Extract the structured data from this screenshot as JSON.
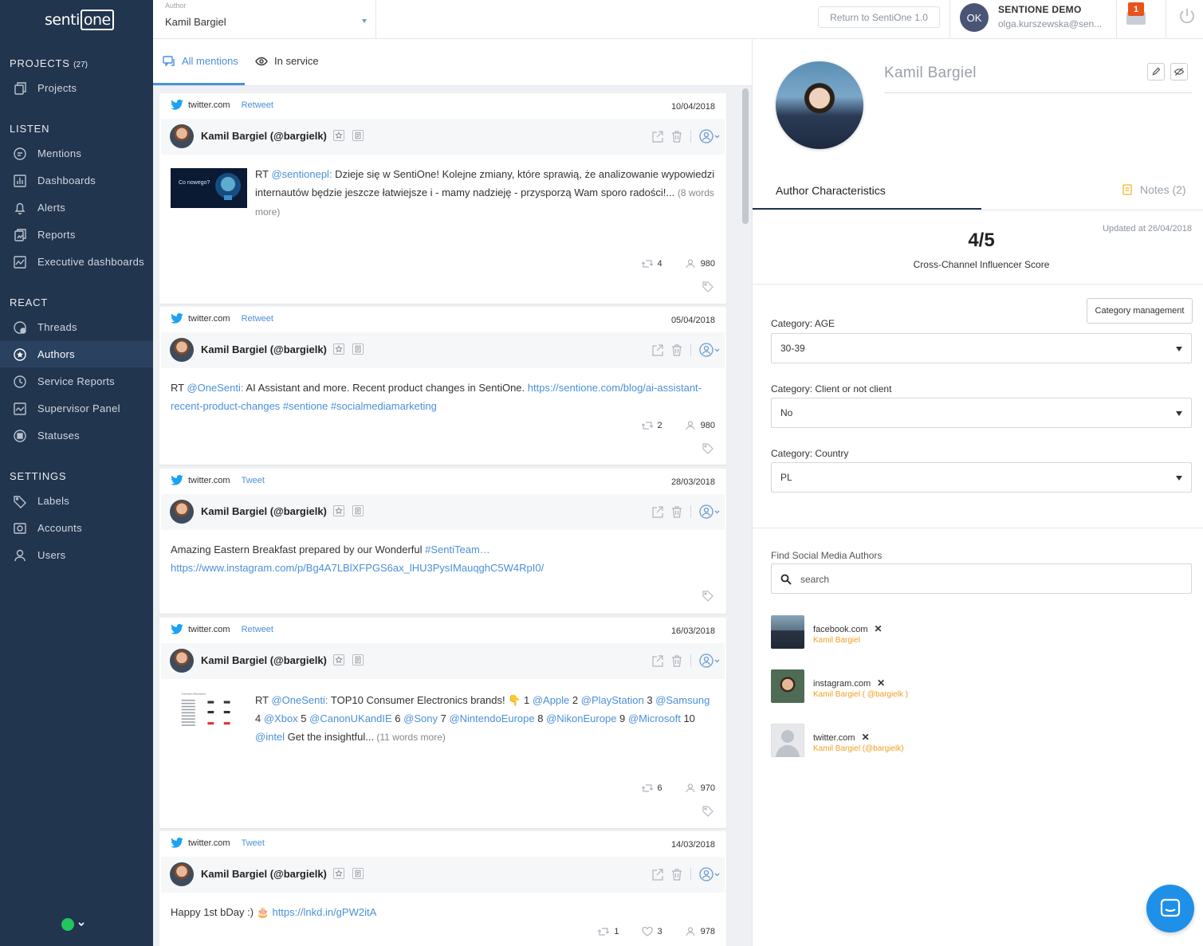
{
  "app": {
    "logo_text_a": "senti",
    "logo_text_b": "one"
  },
  "sidebar": {
    "projects_header": "PROJECTS",
    "projects_count": "(27)",
    "projects_item": "Projects",
    "listen_header": "LISTEN",
    "listen_items": [
      "Mentions",
      "Dashboards",
      "Alerts",
      "Reports",
      "Executive dashboards"
    ],
    "react_header": "REACT",
    "react_items": [
      "Threads",
      "Authors",
      "Service Reports",
      "Supervisor Panel",
      "Statuses"
    ],
    "settings_header": "SETTINGS",
    "settings_items": [
      "Labels",
      "Accounts",
      "Users"
    ],
    "status_color": "#22c55e"
  },
  "topbar": {
    "author_label": "Author",
    "author_value": "Kamil Bargiel",
    "return_button": "Return to SentiOne 1.0",
    "user_initials": "OK",
    "user_name": "SENTIONE DEMO",
    "user_email": "olga.kurszewska@sen...",
    "notification_count": "1"
  },
  "feed": {
    "tabs": [
      {
        "label": "All mentions",
        "active": true
      },
      {
        "label": "In service",
        "active": false
      }
    ],
    "cards": [
      {
        "source": "twitter.com",
        "kind": "Retweet",
        "date": "10/04/2018",
        "author": "Kamil Bargiel (@bargielk)",
        "thumb_text": "Co nowego?",
        "text_prefix": "RT ",
        "mention": "@sentionepl:",
        "text_body": " Dzieje się w SentiOne! Kolejne zmiany, które sprawią, że analizowanie wypowiedzi internautów będzie jeszcze łatwiejsze i - mamy nadzieję - przysporzą Wam sporo radości!...",
        "more": "(8 words more)",
        "retweets": "4",
        "reach": "980"
      },
      {
        "source": "twitter.com",
        "kind": "Retweet",
        "date": "05/04/2018",
        "author": "Kamil Bargiel (@bargielk)",
        "text_prefix": "RT ",
        "mention": "@OneSenti:",
        "text_body": " AI Assistant and more. Recent product changes in SentiOne. ",
        "link": "https://sentione.com/blog/ai-assistant-recent-product-changes",
        "hashtags": " #sentione #socialmediamarketing",
        "retweets": "2",
        "reach": "980"
      },
      {
        "source": "twitter.com",
        "kind": "Tweet",
        "date": "28/03/2018",
        "author": "Kamil Bargiel (@bargielk)",
        "text_body": "Amazing Eastern Breakfast prepared by our Wonderful ",
        "hashtag": "#SentiTeam…",
        "link": "https://www.instagram.com/p/Bg4A7LBlXFPGS6ax_lHU3PysIMauqghC5W4RpI0/"
      },
      {
        "source": "twitter.com",
        "kind": "Retweet",
        "date": "16/03/2018",
        "author": "Kamil Bargiel (@bargielk)",
        "thumb_text": "Consumer Electronics",
        "parts": [
          {
            "t": "RT ",
            "l": false
          },
          {
            "t": "@OneSenti:",
            "l": true
          },
          {
            "t": " TOP10 Consumer Electronics brands! 👇 1 ",
            "l": false
          },
          {
            "t": "@Apple",
            "l": true
          },
          {
            "t": " 2 ",
            "l": false
          },
          {
            "t": "@PlayStation",
            "l": true
          },
          {
            "t": " 3 ",
            "l": false
          },
          {
            "t": "@Samsung",
            "l": true
          },
          {
            "t": " 4 ",
            "l": false
          },
          {
            "t": "@Xbox",
            "l": true
          },
          {
            "t": " 5 ",
            "l": false
          },
          {
            "t": "@CanonUKandIE",
            "l": true
          },
          {
            "t": " 6 ",
            "l": false
          },
          {
            "t": "@Sony",
            "l": true
          },
          {
            "t": " 7 ",
            "l": false
          },
          {
            "t": "@NintendoEurope",
            "l": true
          },
          {
            "t": " 8 ",
            "l": false
          },
          {
            "t": "@NikonEurope",
            "l": true
          },
          {
            "t": " 9 ",
            "l": false
          },
          {
            "t": "@Microsoft",
            "l": true
          },
          {
            "t": " 10 ",
            "l": false
          },
          {
            "t": "@intel",
            "l": true
          },
          {
            "t": " Get the insightful...",
            "l": false
          }
        ],
        "more": "(11 words more)",
        "retweets": "6",
        "reach": "970"
      },
      {
        "source": "twitter.com",
        "kind": "Tweet",
        "date": "14/03/2018",
        "author": "Kamil Bargiel (@bargielk)",
        "text_body": "Happy 1st bDay :) 🎂 ",
        "link": "https://lnkd.in/gPW2itA",
        "retweets": "1",
        "likes": "3",
        "reach": "978"
      }
    ]
  },
  "profile": {
    "name": "Kamil Bargiel",
    "tab_characteristics": "Author Characteristics",
    "tab_notes": "Notes (2)",
    "updated": "Updated at 26/04/2018",
    "score": "4/5",
    "score_label": "Cross-Channel Influencer Score",
    "category_management": "Category management",
    "categories": [
      {
        "label": "Category: AGE",
        "value": "30-39"
      },
      {
        "label": "Category: Client or not client",
        "value": "No"
      },
      {
        "label": "Category: Country",
        "value": "PL"
      }
    ],
    "find_label": "Find Social Media Authors",
    "search_placeholder": "search",
    "accounts": [
      {
        "domain": "facebook.com",
        "name": "Kamil Bargiel"
      },
      {
        "domain": "instagram.com",
        "name": "Kamil Bargiel ( @bargielk )"
      },
      {
        "domain": "twitter.com",
        "name": "Kamil Bargiel (@bargielk)"
      }
    ],
    "accent_color": "#f0a020"
  }
}
